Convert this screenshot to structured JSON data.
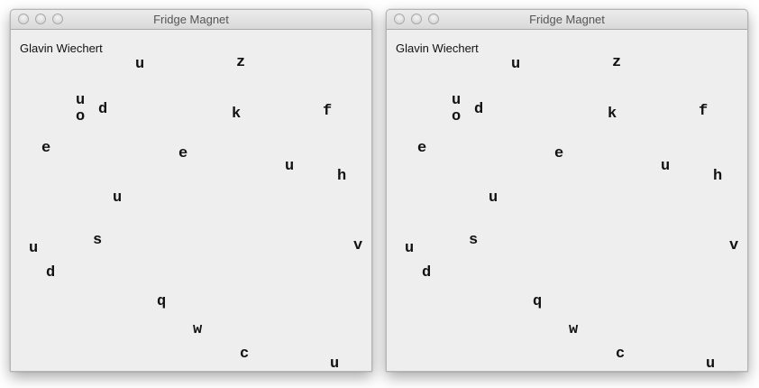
{
  "windows": [
    {
      "title": "Fridge Magnet",
      "author": "Glavin Wiechert",
      "magnets": [
        "u",
        "z",
        "u",
        "d",
        "o",
        "k",
        "f",
        "e",
        "e",
        "u",
        "h",
        "u",
        "s",
        "v",
        "u",
        "d",
        "q",
        "w",
        "c",
        "u"
      ]
    },
    {
      "title": "Fridge Magnet",
      "author": "Glavin Wiechert",
      "magnets": [
        "u",
        "z",
        "u",
        "d",
        "o",
        "k",
        "f",
        "e",
        "e",
        "u",
        "h",
        "u",
        "s",
        "v",
        "u",
        "d",
        "q",
        "w",
        "c",
        "u"
      ]
    }
  ]
}
